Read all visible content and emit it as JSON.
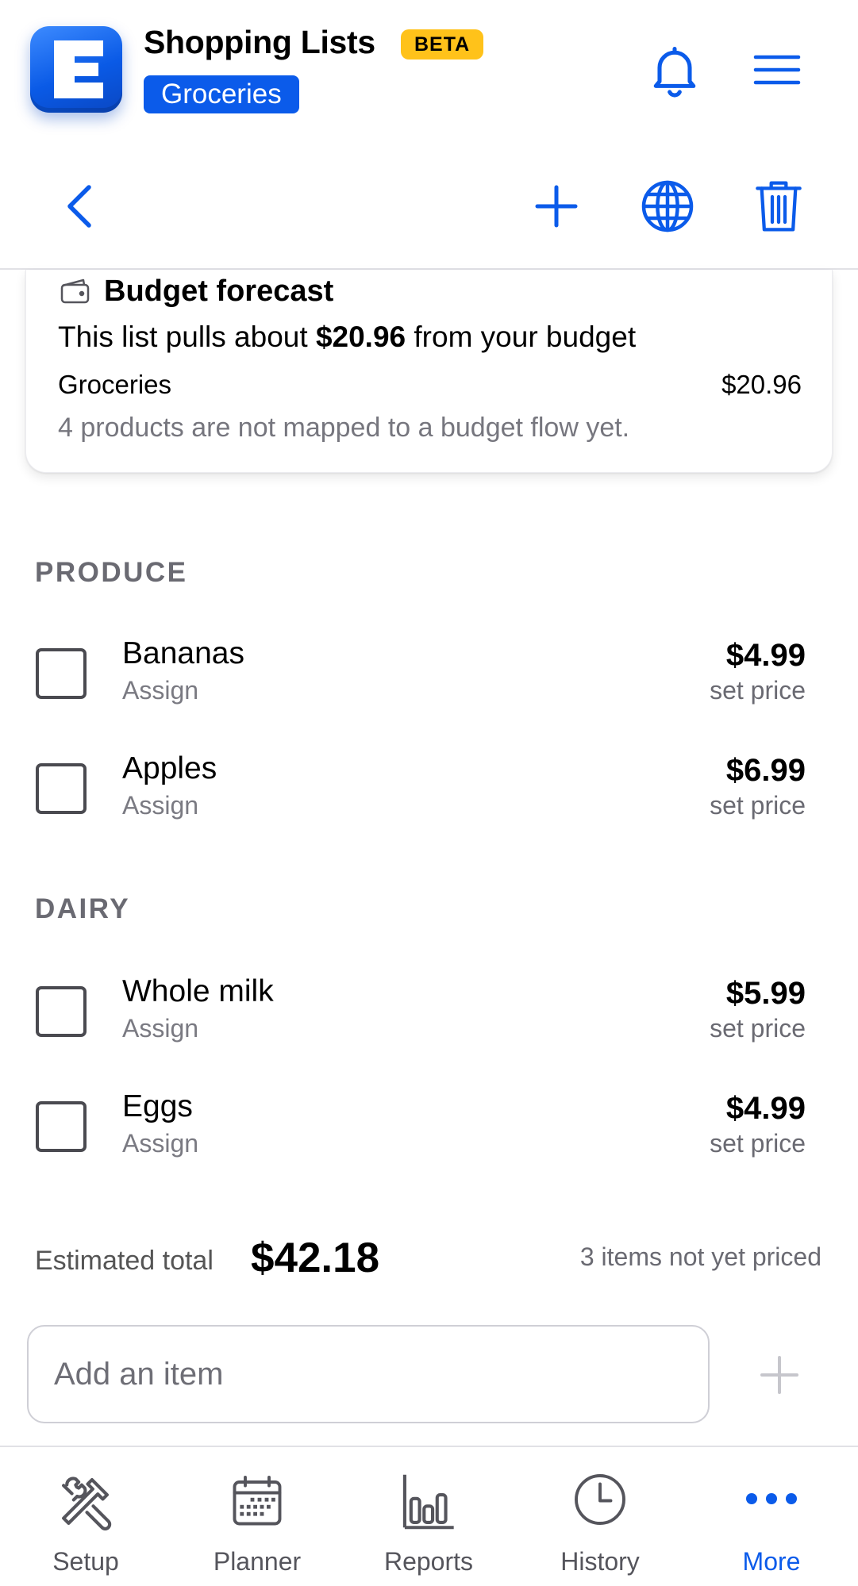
{
  "header": {
    "app_title": "Shopping Lists",
    "beta_badge": "BETA",
    "list_name": "Groceries",
    "logo_letter": "E"
  },
  "toolbar": {
    "back": "chevron-left-icon",
    "add": "plus-icon",
    "share": "globe-icon",
    "delete": "trash-icon"
  },
  "budget": {
    "title": "Budget forecast",
    "sentence_prefix": "This list pulls about",
    "sentence_amount": "$20.96",
    "sentence_suffix": "from your budget",
    "row_name": "Groceries",
    "row_amount": "$20.96",
    "note": "4 products are not mapped to a budget flow yet."
  },
  "sections": [
    {
      "title": "PRODUCE",
      "items": [
        {
          "name": "Bananas",
          "sub": "Assign",
          "price": "$4.99",
          "price_note": "set price",
          "checked": false
        },
        {
          "name": "Apples",
          "sub": "Assign",
          "price": "$6.99",
          "price_note": "set price",
          "checked": false
        }
      ]
    },
    {
      "title": "DAIRY",
      "items": [
        {
          "name": "Whole milk",
          "sub": "Assign",
          "price": "$5.99",
          "price_note": "set price",
          "checked": false
        },
        {
          "name": "Eggs",
          "sub": "Assign",
          "price": "$4.99",
          "price_note": "set price",
          "checked": false
        }
      ]
    }
  ],
  "total": {
    "label": "Estimated total",
    "value": "$42.18",
    "note": "3 items not yet priced"
  },
  "add_item": {
    "placeholder": "Add an item",
    "value": ""
  },
  "tabs": [
    {
      "label": "Setup",
      "icon": "tools-icon",
      "active": false
    },
    {
      "label": "Planner",
      "icon": "calendar-icon",
      "active": false
    },
    {
      "label": "Reports",
      "icon": "bar-chart-icon",
      "active": false
    },
    {
      "label": "History",
      "icon": "clock-icon",
      "active": false
    },
    {
      "label": "More",
      "icon": "more-dots-icon",
      "active": true
    }
  ],
  "colors": {
    "accent": "#0b5bea",
    "beta": "#ffc21a",
    "muted_text": "#6a6a72",
    "inactive_tab": "#55555c"
  }
}
